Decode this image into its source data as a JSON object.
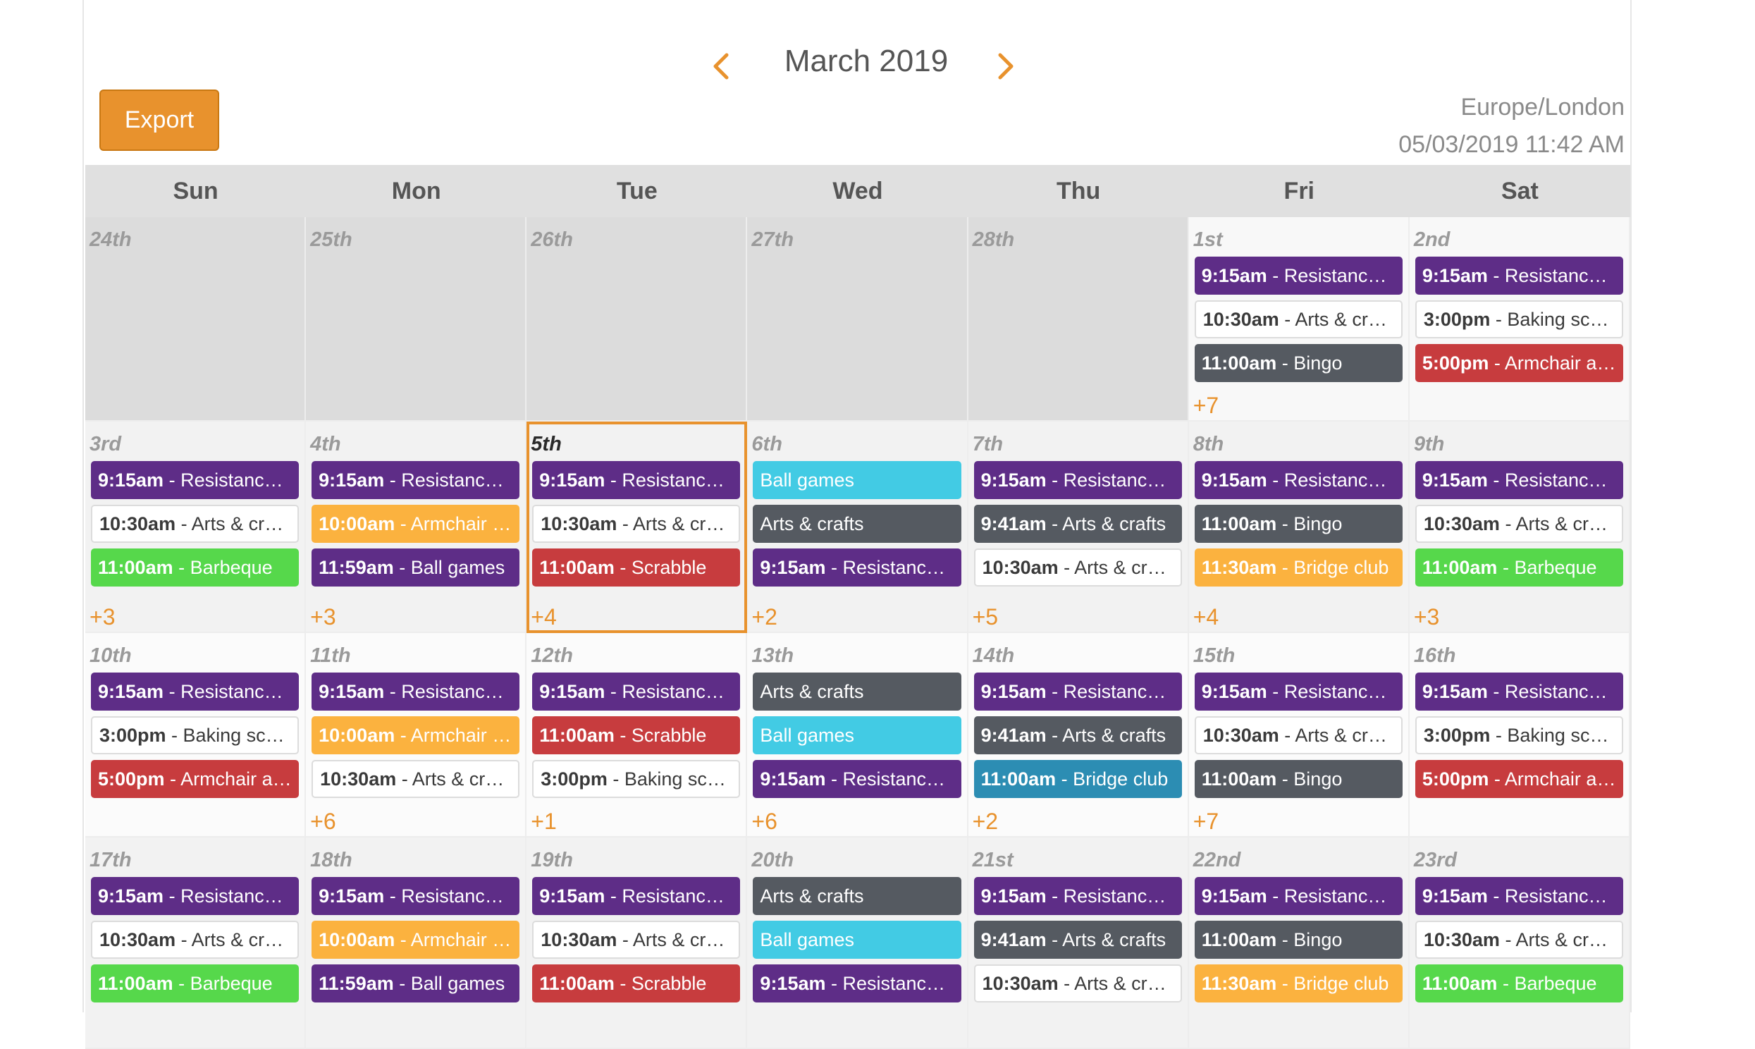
{
  "header": {
    "month_title": "March 2019",
    "prev_icon": "chevron-left-icon",
    "next_icon": "chevron-right-icon",
    "export_label": "Export",
    "timezone": "Europe/London",
    "datetime": "05/03/2019 11:42 AM",
    "accent_color": "#e8922d"
  },
  "weekdays": [
    "Sun",
    "Mon",
    "Tue",
    "Wed",
    "Thu",
    "Fri",
    "Sat"
  ],
  "weeks": [
    [
      {
        "day": "24th",
        "other": true,
        "events": [],
        "more": ""
      },
      {
        "day": "25th",
        "other": true,
        "events": [],
        "more": ""
      },
      {
        "day": "26th",
        "other": true,
        "events": [],
        "more": ""
      },
      {
        "day": "27th",
        "other": true,
        "events": [],
        "more": ""
      },
      {
        "day": "28th",
        "other": true,
        "events": [],
        "more": ""
      },
      {
        "day": "1st",
        "events": [
          {
            "time": "9:15am",
            "title": "Resistance b...",
            "color": "purple"
          },
          {
            "time": "10:30am",
            "title": "Arts & crafts",
            "color": "white"
          },
          {
            "time": "11:00am",
            "title": "Bingo",
            "color": "grey"
          }
        ],
        "more": "+7"
      },
      {
        "day": "2nd",
        "events": [
          {
            "time": "9:15am",
            "title": "Resistance b...",
            "color": "purple"
          },
          {
            "time": "3:00pm",
            "title": "Baking scon...",
            "color": "white"
          },
          {
            "time": "5:00pm",
            "title": "Armchair ae...",
            "color": "red"
          }
        ],
        "more": ""
      }
    ],
    [
      {
        "day": "3rd",
        "events": [
          {
            "time": "9:15am",
            "title": "Resistance b...",
            "color": "purple"
          },
          {
            "time": "10:30am",
            "title": "Arts & crafts",
            "color": "white"
          },
          {
            "time": "11:00am",
            "title": "Barbeque",
            "color": "green"
          }
        ],
        "more": "+3"
      },
      {
        "day": "4th",
        "events": [
          {
            "time": "9:15am",
            "title": "Resistance b...",
            "color": "purple"
          },
          {
            "time": "10:00am",
            "title": "Armchair a...",
            "color": "orange"
          },
          {
            "time": "11:59am",
            "title": "Ball games",
            "color": "purple"
          }
        ],
        "more": "+3"
      },
      {
        "day": "5th",
        "today": true,
        "events": [
          {
            "time": "9:15am",
            "title": "Resistance ...",
            "color": "purple"
          },
          {
            "time": "10:30am",
            "title": "Arts & crafts",
            "color": "white"
          },
          {
            "time": "11:00am",
            "title": "Scrabble",
            "color": "red"
          }
        ],
        "more": "+4"
      },
      {
        "day": "6th",
        "events": [
          {
            "time": "",
            "title": "Ball games",
            "color": "cyan"
          },
          {
            "time": "",
            "title": "Arts & crafts",
            "color": "grey"
          },
          {
            "time": "9:15am",
            "title": "Resistance b...",
            "color": "purple"
          }
        ],
        "more": "+2"
      },
      {
        "day": "7th",
        "events": [
          {
            "time": "9:15am",
            "title": "Resistance b...",
            "color": "purple"
          },
          {
            "time": "9:41am",
            "title": "Arts & crafts",
            "color": "grey"
          },
          {
            "time": "10:30am",
            "title": "Arts & crafts",
            "color": "white"
          }
        ],
        "more": "+5"
      },
      {
        "day": "8th",
        "events": [
          {
            "time": "9:15am",
            "title": "Resistance b...",
            "color": "purple"
          },
          {
            "time": "11:00am",
            "title": "Bingo",
            "color": "grey"
          },
          {
            "time": "11:30am",
            "title": "Bridge club",
            "color": "orange"
          }
        ],
        "more": "+4"
      },
      {
        "day": "9th",
        "events": [
          {
            "time": "9:15am",
            "title": "Resistance b...",
            "color": "purple"
          },
          {
            "time": "10:30am",
            "title": "Arts & crafts",
            "color": "white"
          },
          {
            "time": "11:00am",
            "title": "Barbeque",
            "color": "green"
          }
        ],
        "more": "+3"
      }
    ],
    [
      {
        "day": "10th",
        "events": [
          {
            "time": "9:15am",
            "title": "Resistance b...",
            "color": "purple"
          },
          {
            "time": "3:00pm",
            "title": "Baking scon...",
            "color": "white"
          },
          {
            "time": "5:00pm",
            "title": "Armchair ae...",
            "color": "red"
          }
        ],
        "more": ""
      },
      {
        "day": "11th",
        "events": [
          {
            "time": "9:15am",
            "title": "Resistance b...",
            "color": "purple"
          },
          {
            "time": "10:00am",
            "title": "Armchair a...",
            "color": "orange"
          },
          {
            "time": "10:30am",
            "title": "Arts & crafts",
            "color": "white"
          }
        ],
        "more": "+6"
      },
      {
        "day": "12th",
        "events": [
          {
            "time": "9:15am",
            "title": "Resistance b...",
            "color": "purple"
          },
          {
            "time": "11:00am",
            "title": "Scrabble",
            "color": "red"
          },
          {
            "time": "3:00pm",
            "title": "Baking scon...",
            "color": "white"
          }
        ],
        "more": "+1"
      },
      {
        "day": "13th",
        "events": [
          {
            "time": "",
            "title": "Arts & crafts",
            "color": "grey"
          },
          {
            "time": "",
            "title": "Ball games",
            "color": "cyan"
          },
          {
            "time": "9:15am",
            "title": "Resistance b...",
            "color": "purple"
          }
        ],
        "more": "+6"
      },
      {
        "day": "14th",
        "events": [
          {
            "time": "9:15am",
            "title": "Resistance b...",
            "color": "purple"
          },
          {
            "time": "9:41am",
            "title": "Arts & crafts",
            "color": "grey"
          },
          {
            "time": "11:00am",
            "title": "Bridge club",
            "color": "teal"
          }
        ],
        "more": "+2"
      },
      {
        "day": "15th",
        "events": [
          {
            "time": "9:15am",
            "title": "Resistance b...",
            "color": "purple"
          },
          {
            "time": "10:30am",
            "title": "Arts & crafts",
            "color": "white"
          },
          {
            "time": "11:00am",
            "title": "Bingo",
            "color": "grey"
          }
        ],
        "more": "+7"
      },
      {
        "day": "16th",
        "events": [
          {
            "time": "9:15am",
            "title": "Resistance b...",
            "color": "purple"
          },
          {
            "time": "3:00pm",
            "title": "Baking scon...",
            "color": "white"
          },
          {
            "time": "5:00pm",
            "title": "Armchair ae...",
            "color": "red"
          }
        ],
        "more": ""
      }
    ],
    [
      {
        "day": "17th",
        "events": [
          {
            "time": "9:15am",
            "title": "Resistance b...",
            "color": "purple"
          },
          {
            "time": "10:30am",
            "title": "Arts & crafts",
            "color": "white"
          },
          {
            "time": "11:00am",
            "title": "Barbeque",
            "color": "green"
          }
        ],
        "more": ""
      },
      {
        "day": "18th",
        "events": [
          {
            "time": "9:15am",
            "title": "Resistance b...",
            "color": "purple"
          },
          {
            "time": "10:00am",
            "title": "Armchair a...",
            "color": "orange"
          },
          {
            "time": "11:59am",
            "title": "Ball games",
            "color": "purple"
          }
        ],
        "more": ""
      },
      {
        "day": "19th",
        "events": [
          {
            "time": "9:15am",
            "title": "Resistance b...",
            "color": "purple"
          },
          {
            "time": "10:30am",
            "title": "Arts & crafts",
            "color": "white"
          },
          {
            "time": "11:00am",
            "title": "Scrabble",
            "color": "red"
          }
        ],
        "more": ""
      },
      {
        "day": "20th",
        "events": [
          {
            "time": "",
            "title": "Arts & crafts",
            "color": "grey"
          },
          {
            "time": "",
            "title": "Ball games",
            "color": "cyan"
          },
          {
            "time": "9:15am",
            "title": "Resistance b...",
            "color": "purple"
          }
        ],
        "more": ""
      },
      {
        "day": "21st",
        "events": [
          {
            "time": "9:15am",
            "title": "Resistance b...",
            "color": "purple"
          },
          {
            "time": "9:41am",
            "title": "Arts & crafts",
            "color": "grey"
          },
          {
            "time": "10:30am",
            "title": "Arts & crafts",
            "color": "white"
          }
        ],
        "more": ""
      },
      {
        "day": "22nd",
        "events": [
          {
            "time": "9:15am",
            "title": "Resistance b...",
            "color": "purple"
          },
          {
            "time": "11:00am",
            "title": "Bingo",
            "color": "grey"
          },
          {
            "time": "11:30am",
            "title": "Bridge club",
            "color": "orange"
          }
        ],
        "more": ""
      },
      {
        "day": "23rd",
        "events": [
          {
            "time": "9:15am",
            "title": "Resistance b...",
            "color": "purple"
          },
          {
            "time": "10:30am",
            "title": "Arts & crafts",
            "color": "white"
          },
          {
            "time": "11:00am",
            "title": "Barbeque",
            "color": "green"
          }
        ],
        "more": ""
      }
    ]
  ]
}
